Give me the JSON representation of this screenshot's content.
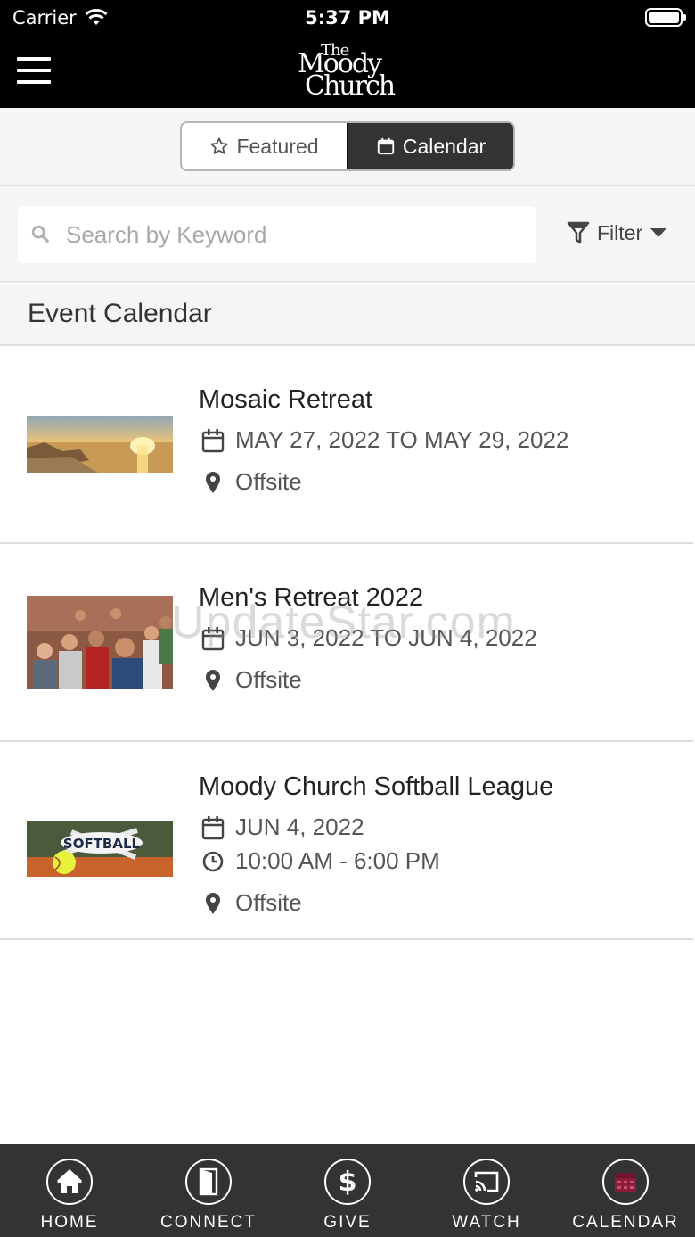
{
  "status_bar": {
    "carrier": "Carrier",
    "time": "5:37 PM"
  },
  "header": {
    "logo_line1": "The",
    "logo_line2": "Moody",
    "logo_line3": "Church"
  },
  "segment": {
    "featured_label": "Featured",
    "calendar_label": "Calendar",
    "active": "calendar"
  },
  "search": {
    "placeholder": "Search by Keyword",
    "value": ""
  },
  "filter_label": "Filter",
  "section_title": "Event Calendar",
  "events": [
    {
      "title": "Mosaic Retreat",
      "date": "MAY 27, 2022 TO MAY 29, 2022",
      "location": "Offsite"
    },
    {
      "title": "Men's Retreat 2022",
      "date": "JUN 3, 2022 TO JUN 4, 2022",
      "location": "Offsite"
    },
    {
      "title": "Moody Church Softball League",
      "date": "JUN 4, 2022",
      "time": "10:00 AM - 6:00 PM",
      "location": "Offsite"
    }
  ],
  "watermark": "UpdateStar.com",
  "tabs": [
    {
      "label": "HOME",
      "icon": "home-icon"
    },
    {
      "label": "CONNECT",
      "icon": "door-icon"
    },
    {
      "label": "GIVE",
      "icon": "dollar-icon"
    },
    {
      "label": "WATCH",
      "icon": "cast-icon"
    },
    {
      "label": "CALENDAR",
      "icon": "calendar-icon"
    }
  ],
  "colors": {
    "header_bg": "#000000",
    "tabbar_bg": "#333333",
    "accent_calendar": "#8b1d3a",
    "panel_bg": "#f5f5f5"
  }
}
